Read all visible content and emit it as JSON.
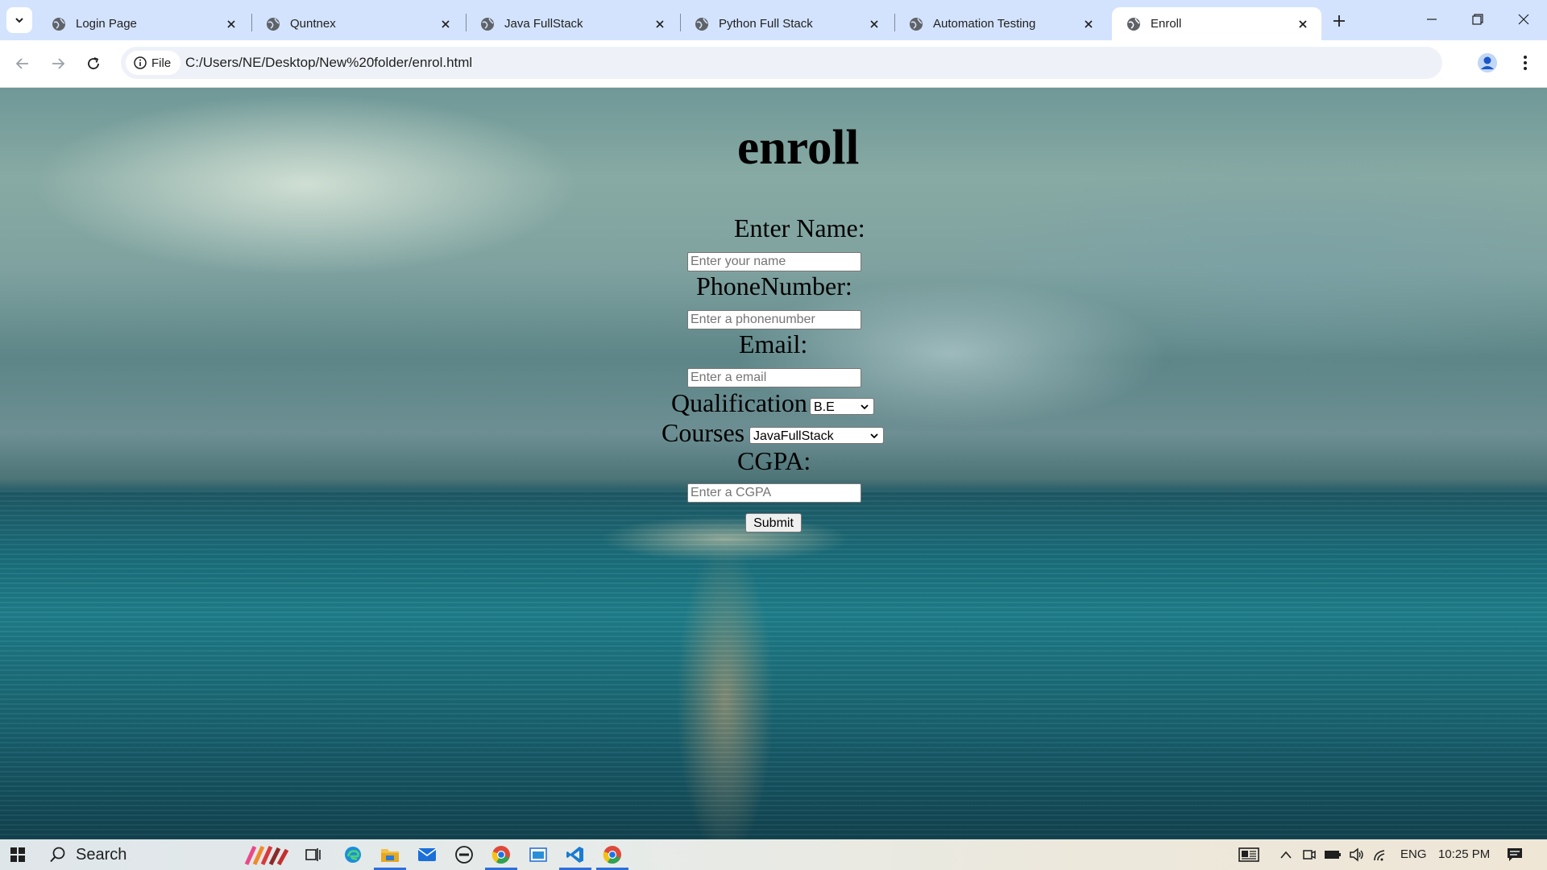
{
  "browser": {
    "tabs": [
      {
        "title": "Login Page",
        "active": false
      },
      {
        "title": "Quntnex",
        "active": false
      },
      {
        "title": "Java FullStack",
        "active": false
      },
      {
        "title": "Python Full Stack",
        "active": false
      },
      {
        "title": "Automation Testing",
        "active": false
      },
      {
        "title": "Enroll",
        "active": true
      }
    ],
    "address": {
      "chip_label": "File",
      "url": "C:/Users/NE/Desktop/New%20folder/enrol.html"
    }
  },
  "page": {
    "heading": "enroll",
    "name_label": "Enter Name:",
    "name_placeholder": "Enter your name",
    "phone_label": "PhoneNumber:",
    "phone_placeholder": "Enter a phonenumber",
    "email_label": "Email:",
    "email_placeholder": "Enter a email",
    "qualification_label": "Qualification",
    "qualification_selected": "B.E",
    "courses_label": "Courses",
    "courses_selected": "JavaFullStack",
    "cgpa_label": "CGPA:",
    "cgpa_placeholder": "Enter a CGPA",
    "submit_label": "Submit"
  },
  "taskbar": {
    "search_label": "Search",
    "language": "ENG",
    "time": "10:25 PM"
  },
  "colors": {
    "tabstrip": "#d3e3fd",
    "active_tab": "#ffffff",
    "omnibox": "#eef2f8",
    "taskbar_accent": "#2f6fd8"
  }
}
